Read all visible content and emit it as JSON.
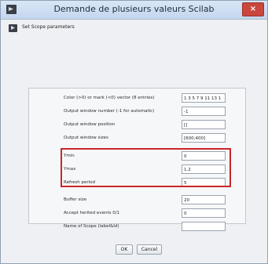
{
  "window": {
    "title": "Demande de plusieurs valeurs Scilab",
    "close_label": "×"
  },
  "header": {
    "text": "Set Scope parameters"
  },
  "form": {
    "rows": [
      {
        "label": "Color (>0) or mark (<0) vector (8 entries)",
        "value": "1 3 5 7 9 11 13 1"
      },
      {
        "label": "Output window number (-1 for automatic)",
        "value": "-1"
      },
      {
        "label": "Output window position",
        "value": "[]"
      },
      {
        "label": "Output window sizes",
        "value": "[600;400]"
      },
      {
        "label": "Ymin",
        "value": "0"
      },
      {
        "label": "Ymax",
        "value": "1.2"
      },
      {
        "label": "Refresh period",
        "value": "5"
      },
      {
        "label": "Buffer size",
        "value": "20"
      },
      {
        "label": "Accept herited events 0/1",
        "value": "0"
      },
      {
        "label": "Name of Scope (label&Id)",
        "value": ""
      }
    ]
  },
  "buttons": {
    "ok": "OK",
    "cancel": "Cancel"
  },
  "colors": {
    "highlight": "#c9262b",
    "close": "#c9473d",
    "titlebar": "#c4d6ee"
  }
}
